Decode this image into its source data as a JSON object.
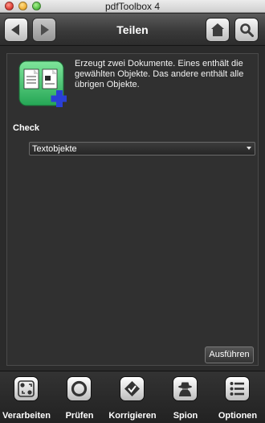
{
  "window": {
    "title": "pdfToolbox 4"
  },
  "toolbar": {
    "view_title": "Teilen",
    "back_icon": "arrow-left-icon",
    "forward_icon": "arrow-right-icon",
    "home_icon": "home-icon",
    "search_icon": "magnifier-icon"
  },
  "main": {
    "icon": "split-documents-icon",
    "description": "Erzeugt zwei Dokumente. Eines enthält die gewählten Objekte. Das andere enthält alle übrigen Objekte.",
    "check_label": "Check",
    "check_select": {
      "value": "Textobjekte"
    },
    "run_label": "Ausführen"
  },
  "tabs": [
    {
      "label": "Verarbeiten",
      "icon": "process-icon"
    },
    {
      "label": "Prüfen",
      "icon": "inspect-icon"
    },
    {
      "label": "Korrigieren",
      "icon": "correct-icon"
    },
    {
      "label": "Spion",
      "icon": "spy-icon"
    },
    {
      "label": "Optionen",
      "icon": "options-list-icon"
    }
  ],
  "colors": {
    "background": "#2b2b2b",
    "panel": "#303030",
    "icon_green": "#3fbf6a",
    "icon_plus": "#2a3fd6"
  }
}
